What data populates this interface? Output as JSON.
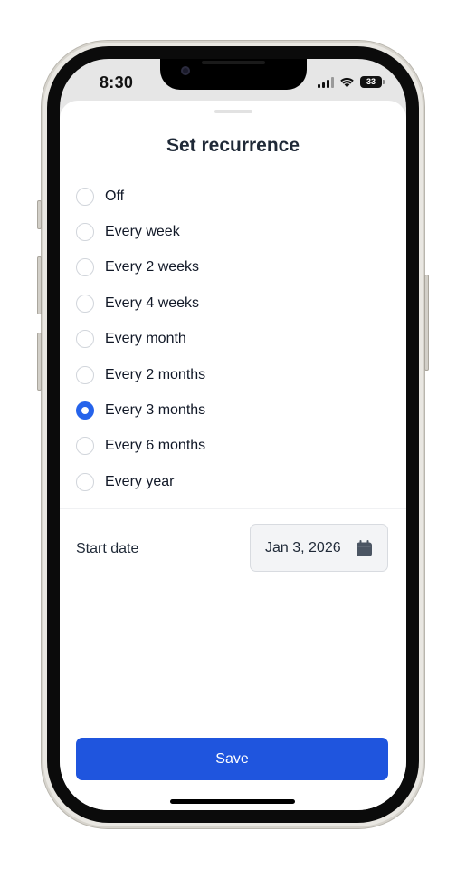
{
  "status_bar": {
    "time": "8:30",
    "battery": "33",
    "icons": [
      "signal-icon",
      "wifi-icon",
      "battery-icon"
    ]
  },
  "sheet": {
    "title": "Set recurrence",
    "options": [
      {
        "label": "Off",
        "selected": false
      },
      {
        "label": "Every week",
        "selected": false
      },
      {
        "label": "Every 2 weeks",
        "selected": false
      },
      {
        "label": "Every 4 weeks",
        "selected": false
      },
      {
        "label": "Every month",
        "selected": false
      },
      {
        "label": "Every 2 months",
        "selected": false
      },
      {
        "label": "Every 3 months",
        "selected": true
      },
      {
        "label": "Every 6 months",
        "selected": false
      },
      {
        "label": "Every year",
        "selected": false
      }
    ],
    "start_date_label": "Start date",
    "start_date_value": "Jan 3, 2026",
    "save_label": "Save"
  },
  "colors": {
    "accent": "#2563eb",
    "save_button": "#1f55de",
    "text": "#111827",
    "field_bg": "#f3f4f6"
  }
}
